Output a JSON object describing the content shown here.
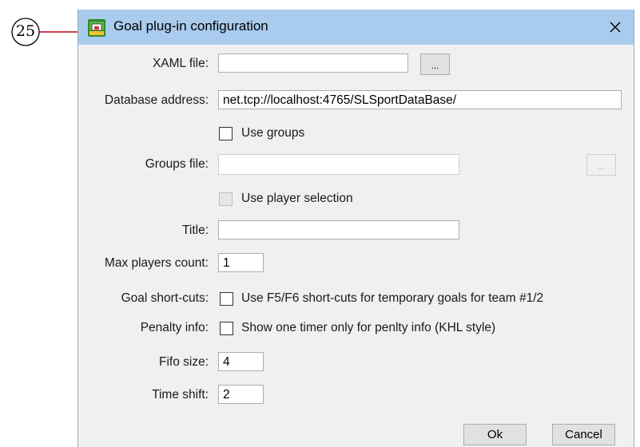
{
  "callout": {
    "number": "25"
  },
  "window": {
    "title": "Goal plug-in configuration",
    "icon": "goal-plugin-icon",
    "close_icon": "close-icon"
  },
  "form": {
    "xaml_label": "XAML file:",
    "xaml_value": "",
    "xaml_browse": "...",
    "db_label": "Database address:",
    "db_value": "net.tcp://localhost:4765/SLSportDataBase/",
    "use_groups": {
      "label": "Use groups",
      "checked": false
    },
    "groups_label": "Groups file:",
    "groups_value": "",
    "groups_browse": "...",
    "use_player_selection": {
      "label": "Use player selection",
      "checked": false,
      "enabled": false
    },
    "title_label": "Title:",
    "title_value": "",
    "max_players_label": "Max players count:",
    "max_players_value": "1",
    "shortcuts_label": "Goal short-cuts:",
    "shortcuts_check": {
      "label": "Use F5/F6 short-cuts for temporary goals for team #1/2",
      "checked": false
    },
    "penalty_label": "Penalty info:",
    "penalty_check": {
      "label": "Show one timer only for penlty info (KHL style)",
      "checked": false
    },
    "fifo_label": "Fifo size:",
    "fifo_value": "4",
    "timeshift_label": "Time shift:",
    "timeshift_value": "2"
  },
  "buttons": {
    "ok": "Ok",
    "cancel": "Cancel"
  },
  "colors": {
    "titlebar": "#a9cbee",
    "callout_line": "#c0001a",
    "body": "#f0f0f0"
  }
}
